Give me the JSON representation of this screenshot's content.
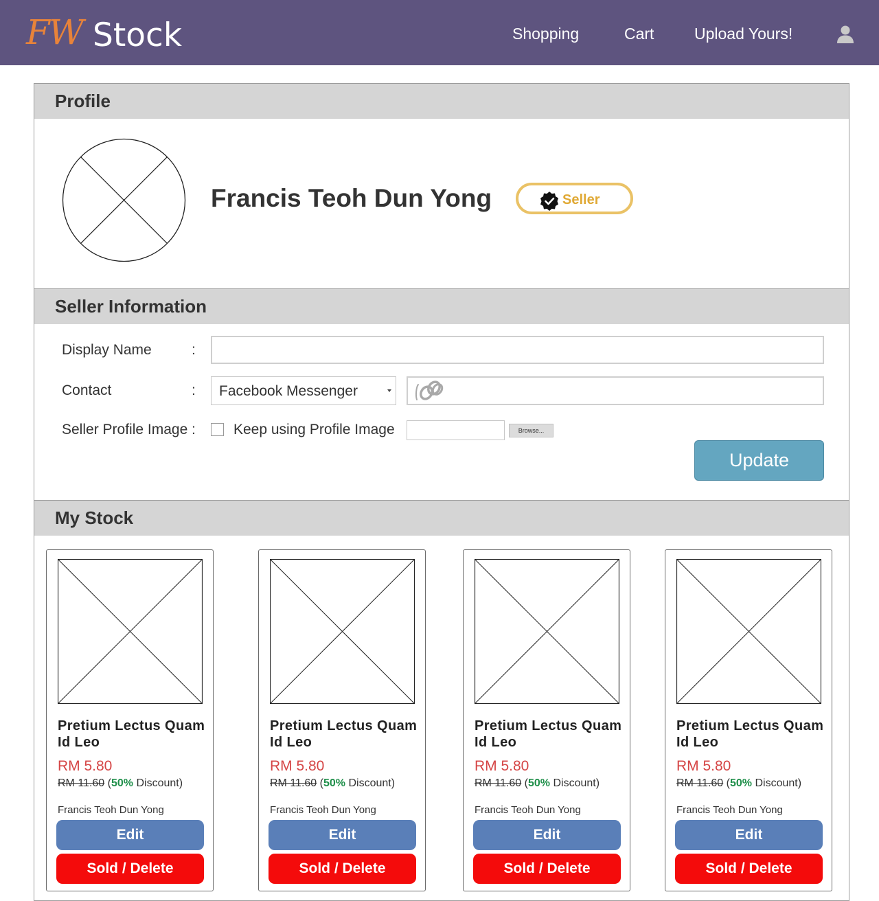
{
  "header": {
    "logo_fw": "FW",
    "logo_stock": "Stock",
    "nav": {
      "shopping": "Shopping",
      "cart": "Cart",
      "upload": "Upload Yours!"
    },
    "user_icon": "user-icon",
    "bg_color": "#5e547f",
    "logo_accent": "#e8833a"
  },
  "profile": {
    "heading": "Profile",
    "name": "Francis Teoh Dun Yong",
    "badge_label": "Seller",
    "badge_icon": "verified-check-icon",
    "badge_color": "#eac266"
  },
  "seller_info": {
    "heading": "Seller Information",
    "display_name_label": "Display Name",
    "display_name_value": "",
    "contact_label": "Contact",
    "contact_method": "Facebook Messenger",
    "contact_value": "",
    "contact_icon": "link-icon",
    "profile_image_label": "Seller Profile Image",
    "keep_profile_image_label": "Keep using Profile Image",
    "keep_profile_image_checked": false,
    "browse_label": "Browse...",
    "update_label": "Update",
    "colon": ":"
  },
  "my_stock": {
    "heading": "My Stock",
    "items": [
      {
        "title": "Pretium Lectus Quam Id Leo",
        "price": "RM 5.80",
        "old_price": "RM 11.60",
        "discount_pct": "50%",
        "discount_word": "Discount",
        "seller": "Francis Teoh Dun Yong",
        "edit_label": "Edit",
        "delete_label": "Sold / Delete"
      },
      {
        "title": "Pretium Lectus Quam Id Leo",
        "price": "RM 5.80",
        "old_price": "RM 11.60",
        "discount_pct": "50%",
        "discount_word": "Discount",
        "seller": "Francis Teoh Dun Yong",
        "edit_label": "Edit",
        "delete_label": "Sold / Delete"
      },
      {
        "title": "Pretium Lectus Quam Id Leo",
        "price": "RM 5.80",
        "old_price": "RM 11.60",
        "discount_pct": "50%",
        "discount_word": "Discount",
        "seller": "Francis Teoh Dun Yong",
        "edit_label": "Edit",
        "delete_label": "Sold / Delete"
      },
      {
        "title": "Pretium Lectus Quam Id Leo",
        "price": "RM 5.80",
        "old_price": "RM 11.60",
        "discount_pct": "50%",
        "discount_word": "Discount",
        "seller": "Francis Teoh Dun Yong",
        "edit_label": "Edit",
        "delete_label": "Sold / Delete"
      }
    ]
  },
  "colors": {
    "edit_button": "#5a7fb8",
    "delete_button": "#f40b0b",
    "update_button": "#64a6c0",
    "price": "#d54545",
    "discount": "#1f8f4a"
  }
}
